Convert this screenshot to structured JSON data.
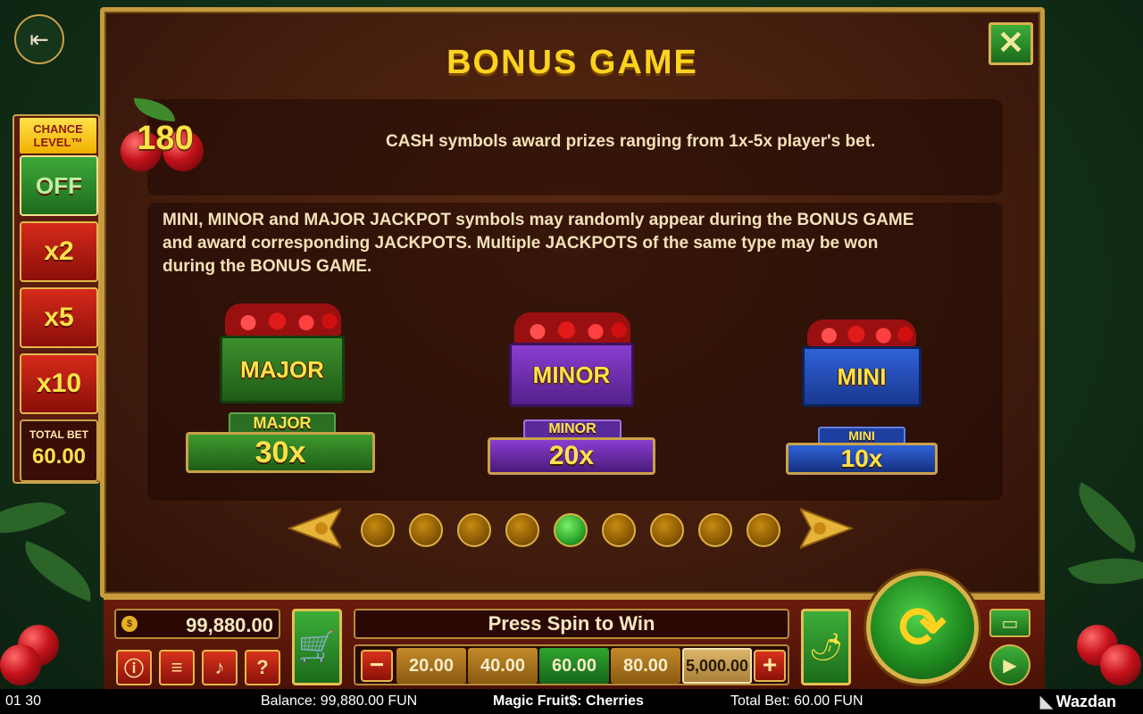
{
  "dialog": {
    "title": "BONUS GAME",
    "close_icon": "close-icon",
    "cash": {
      "symbol_value": "180",
      "text": "CASH symbols award prizes ranging from 1x-5x player's bet."
    },
    "jackpot_text": [
      "MINI, MINOR and MAJOR JACKPOT symbols may randomly appear during the BONUS GAME",
      "and award corresponding JACKPOTS. Multiple JACKPOTS of the same type may be won",
      "during the BONUS GAME."
    ],
    "jackpots": [
      {
        "crate_label": "MAJOR",
        "tag": "MAJOR",
        "multiplier": "30x",
        "color": "#2f7a24"
      },
      {
        "crate_label": "MINOR",
        "tag": "MINOR",
        "multiplier": "20x",
        "color": "#6a2ab0"
      },
      {
        "crate_label": "MINI",
        "tag": "MINI",
        "multiplier": "10x",
        "color": "#2446b8"
      }
    ],
    "pager": {
      "pages": 9,
      "active_page": 5
    }
  },
  "chance_level": {
    "header": [
      "CHANCE",
      "LEVEL™"
    ],
    "options": [
      "OFF",
      "x2",
      "x5",
      "x10"
    ],
    "selected": "OFF",
    "total_bet_label": "TOTAL BET",
    "total_bet_value": "60.00"
  },
  "controls": {
    "balance": "99,880.00",
    "message": "Press Spin to Win",
    "bet_options": [
      "20.00",
      "40.00",
      "60.00",
      "80.00",
      "5,000.00"
    ],
    "selected_bet": "60.00",
    "minus": "−",
    "plus": "+",
    "question": "?"
  },
  "status_bar": {
    "time": "01 30",
    "balance": "Balance: 99,880.00 FUN",
    "game_title": "Magic Fruit$: Cherries",
    "total_bet": "Total Bet: 60.00 FUN",
    "brand": "Wazdan"
  },
  "colors": {
    "accent_gold": "#ffd21f",
    "active_green": "#2aa52a",
    "frame": "#c79a3d"
  }
}
